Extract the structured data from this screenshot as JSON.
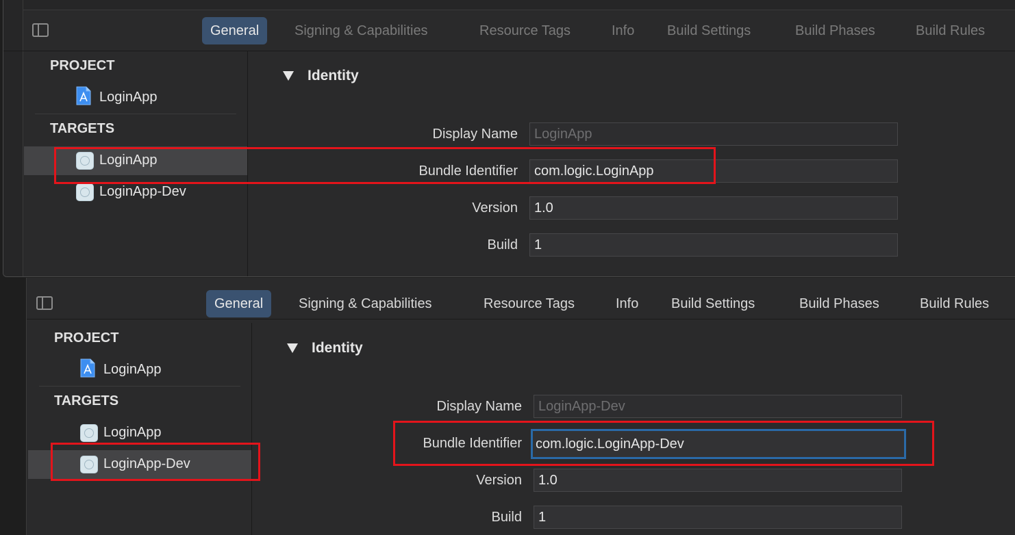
{
  "panels": [
    {
      "tabs": [
        {
          "label": "General",
          "active": true
        },
        {
          "label": "Signing & Capabilities"
        },
        {
          "label": "Resource Tags"
        },
        {
          "label": "Info"
        },
        {
          "label": "Build Settings"
        },
        {
          "label": "Build Phases"
        },
        {
          "label": "Build Rules"
        }
      ],
      "sidebar": {
        "project_header": "PROJECT",
        "project_item": "LoginApp",
        "targets_header": "TARGETS",
        "targets": [
          {
            "label": "LoginApp",
            "selected": true
          },
          {
            "label": "LoginApp-Dev",
            "selected": false
          }
        ]
      },
      "identity": {
        "section_title": "Identity",
        "fields": [
          {
            "label": "Display Name",
            "value": "LoginApp"
          },
          {
            "label": "Bundle Identifier",
            "value": "com.logic.LoginApp"
          },
          {
            "label": "Version",
            "value": "1.0"
          },
          {
            "label": "Build",
            "value": "1"
          }
        ]
      }
    },
    {
      "tabs": [
        {
          "label": "General",
          "active": true
        },
        {
          "label": "Signing & Capabilities"
        },
        {
          "label": "Resource Tags"
        },
        {
          "label": "Info"
        },
        {
          "label": "Build Settings"
        },
        {
          "label": "Build Phases"
        },
        {
          "label": "Build Rules"
        }
      ],
      "sidebar": {
        "project_header": "PROJECT",
        "project_item": "LoginApp",
        "targets_header": "TARGETS",
        "targets": [
          {
            "label": "LoginApp",
            "selected": false
          },
          {
            "label": "LoginApp-Dev",
            "selected": true
          }
        ]
      },
      "identity": {
        "section_title": "Identity",
        "fields": [
          {
            "label": "Display Name",
            "value": "LoginApp-Dev"
          },
          {
            "label": "Bundle Identifier",
            "value": "com.logic.LoginApp-Dev"
          },
          {
            "label": "Version",
            "value": "1.0"
          },
          {
            "label": "Build",
            "value": "1"
          }
        ]
      }
    }
  ],
  "colors": {
    "highlight": "#e3141b",
    "tab_active": "#3a5270",
    "focus_ring": "#2a6aa8"
  }
}
